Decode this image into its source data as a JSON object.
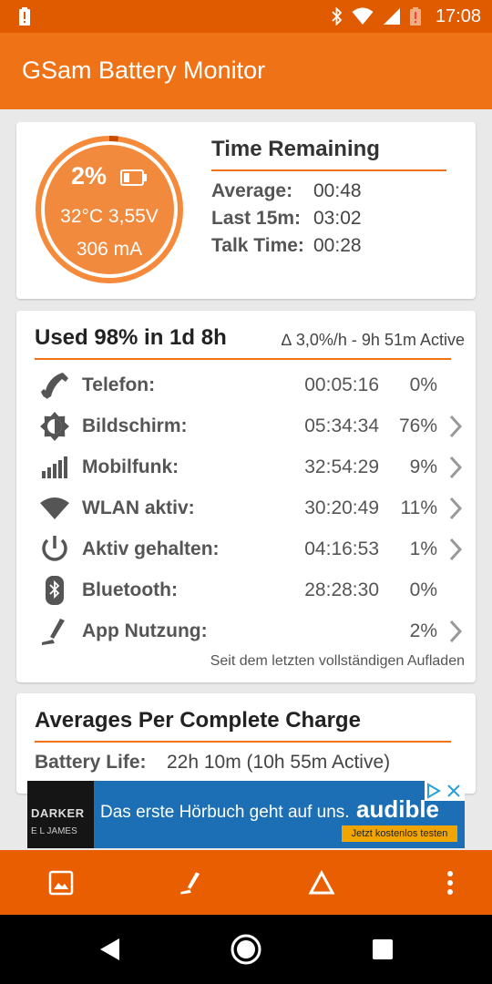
{
  "status_bar": {
    "time": "17:08",
    "icons": [
      "battery-alert-icon",
      "bluetooth-icon",
      "wifi-icon",
      "signal-icon",
      "battery-low-icon"
    ]
  },
  "app_bar": {
    "title": "GSam Battery Monitor"
  },
  "battery": {
    "percent": "2%",
    "temp_voltage": "32°C  3,55V",
    "current": "306 mA",
    "level": 0.02,
    "accent_color": "#f07216"
  },
  "time_remaining": {
    "title": "Time Remaining",
    "rows": [
      {
        "label": "Average:",
        "value": "00:48"
      },
      {
        "label": "Last 15m:",
        "value": "03:02"
      },
      {
        "label": "Talk Time:",
        "value": "00:28"
      }
    ]
  },
  "usage": {
    "title": "Used 98% in 1d 8h",
    "delta": "∆ 3,0%/h - 9h 51m Active",
    "rows": [
      {
        "icon": "phone-icon",
        "name": "Telefon:",
        "time": "00:05:16",
        "percent": "0%",
        "has_chevron": false
      },
      {
        "icon": "brightness-icon",
        "name": "Bildschirm:",
        "time": "05:34:34",
        "percent": "76%",
        "has_chevron": true
      },
      {
        "icon": "cell-signal-icon",
        "name": "Mobilfunk:",
        "time": "32:54:29",
        "percent": "9%",
        "has_chevron": true
      },
      {
        "icon": "wifi-icon",
        "name": "WLAN aktiv:",
        "time": "30:20:49",
        "percent": "11%",
        "has_chevron": true
      },
      {
        "icon": "power-icon",
        "name": "Aktiv gehalten:",
        "time": "04:16:53",
        "percent": "1%",
        "has_chevron": true
      },
      {
        "icon": "bluetooth-icon",
        "name": "Bluetooth:",
        "time": "28:28:30",
        "percent": "0%",
        "has_chevron": false
      },
      {
        "icon": "app-usage-icon",
        "name": "App Nutzung:",
        "time": "",
        "percent": "2%",
        "has_chevron": true
      }
    ],
    "footer": "Seit dem letzten vollständigen Aufladen"
  },
  "averages": {
    "title": "Averages Per Complete Charge",
    "label": "Battery Life:",
    "value": "22h 10m (10h 55m Active)"
  },
  "ad": {
    "cover_title": "DARKER",
    "cover_author": "E L JAMES",
    "message": "Das erste Hörbuch geht auf uns.",
    "brand": "audible",
    "cta": "Jetzt kostenlos testen"
  },
  "toolbar": {
    "icons": [
      "image-icon",
      "app-usage-icon",
      "delta-icon",
      "more-vert-icon"
    ]
  },
  "nav_bar": {
    "icons": [
      "back-icon",
      "home-icon",
      "recents-icon"
    ]
  }
}
